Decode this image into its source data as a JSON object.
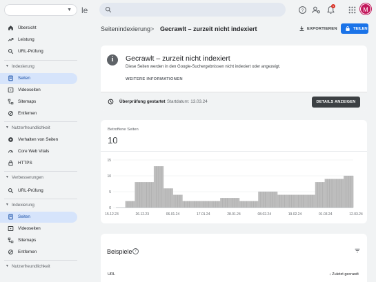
{
  "header": {
    "brand_fragment": "le",
    "notification_count": "1",
    "avatar_letter": "M",
    "avatar_color": "#c2185b"
  },
  "sidebar": {
    "top_items": [
      {
        "label": "Übersicht",
        "icon": "home-icon"
      },
      {
        "label": "Leistung",
        "icon": "trending-up-icon"
      },
      {
        "label": "URL-Prüfung",
        "icon": "search-icon"
      }
    ],
    "sections": [
      {
        "label": "Indexierung",
        "items": [
          {
            "label": "Seiten",
            "icon": "pages-icon",
            "active": true
          },
          {
            "label": "Videoseiten",
            "icon": "video-pages-icon"
          },
          {
            "label": "Sitemaps",
            "icon": "sitemap-icon"
          },
          {
            "label": "Entfernen",
            "icon": "remove-icon"
          }
        ]
      },
      {
        "label": "Nutzerfreundlichkeit",
        "items": [
          {
            "label": "Verhalten von Seiten",
            "icon": "page-experience-icon"
          },
          {
            "label": "Core Web Vitals",
            "icon": "speed-icon"
          },
          {
            "label": "HTTPS",
            "icon": "lock-icon"
          }
        ]
      },
      {
        "label": "Verbesserungen",
        "items": []
      }
    ],
    "repeat_items": [
      {
        "label": "URL-Prüfung",
        "icon": "search-icon"
      }
    ],
    "repeat_sections": [
      {
        "label": "Indexierung",
        "items": [
          {
            "label": "Seiten",
            "icon": "pages-icon",
            "active": true
          },
          {
            "label": "Videoseiten",
            "icon": "video-pages-icon"
          },
          {
            "label": "Sitemaps",
            "icon": "sitemap-icon"
          },
          {
            "label": "Entfernen",
            "icon": "remove-icon"
          }
        ]
      },
      {
        "label": "Nutzerfreundlichkeit",
        "items": []
      }
    ]
  },
  "page": {
    "breadcrumb_parent": "Seitenindexierung",
    "breadcrumb_separator": ">",
    "breadcrumb_current": "Gecrawlt – zurzeit nicht indexiert",
    "export_label": "EXPORTIEREN",
    "share_label": "TEILEN",
    "accent_color": "#1a73e8"
  },
  "info": {
    "title": "Gecrawlt – zurzeit nicht indexiert",
    "description": "Diese Seiten werden in den Google-Suchergebnissen nicht indexiert oder angezeigt.",
    "more_info_label": "WEITERE INFORMATIONEN",
    "validation_status": "Überprüfung gestartet",
    "validation_start": "Startdatum: 13.03.24",
    "details_label": "DETAILS ANZEIGEN"
  },
  "metric": {
    "label": "Betroffene Seiten",
    "value": "10"
  },
  "chart_data": {
    "type": "area",
    "title": "",
    "xlabel": "",
    "ylabel": "",
    "ylim": [
      0,
      15
    ],
    "y_ticks": [
      "0",
      "5",
      "10",
      "15"
    ],
    "x_tick_labels": [
      "15.12.23",
      "26.12.23",
      "06.01.24",
      "17.01.24",
      "28.01.24",
      "08.02.24",
      "19.02.24",
      "01.03.24",
      "12.03.24"
    ],
    "grid": true,
    "series": [
      {
        "values": [
          0,
          2,
          8,
          8,
          13,
          6,
          4,
          2,
          2,
          2,
          2,
          3,
          3,
          2,
          2,
          5,
          5,
          4,
          4,
          4,
          4,
          8,
          9,
          9,
          10
        ]
      }
    ]
  },
  "examples": {
    "title": "Beispiele",
    "help_glyph": "?",
    "col_url": "URL",
    "col_last_crawled": "Zuletzt gecrawlt",
    "sort_glyph": "↓"
  }
}
